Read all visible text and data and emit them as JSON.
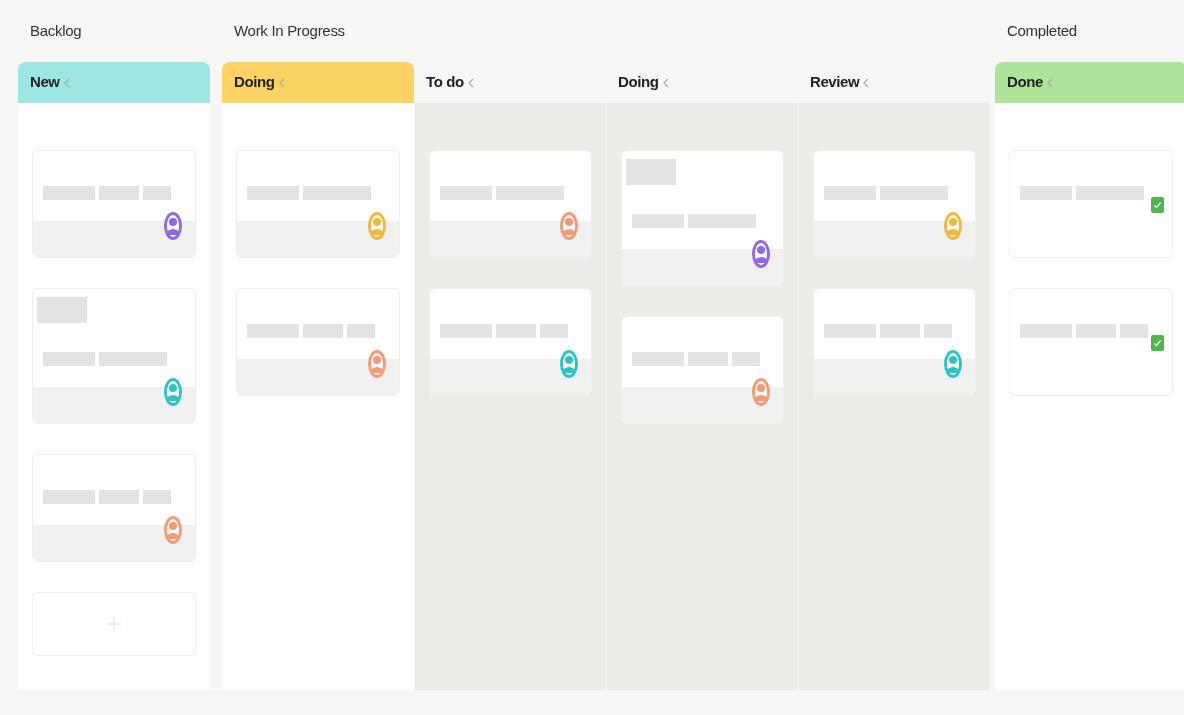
{
  "groups": [
    {
      "title": "Backlog",
      "columns": [
        {
          "name": "New",
          "color": "#9ee6e4",
          "cards": [
            {
              "kind": "task",
              "title_block": false,
              "color": "#8e6ae6"
            },
            {
              "kind": "task",
              "title_block": true,
              "color": "#2ec4c6"
            },
            {
              "kind": "task",
              "title_block": false,
              "color": "#f59a72"
            },
            {
              "kind": "add"
            }
          ]
        }
      ]
    },
    {
      "title": "Work In Progress",
      "columns": [
        {
          "name": "Doing",
          "color": "#fdd265",
          "cards": [
            {
              "kind": "task",
              "title_block": false,
              "color": "#f0b93a"
            },
            {
              "kind": "task",
              "title_block": false,
              "color": "#f59a72"
            }
          ]
        },
        {
          "name": "To do",
          "cards": [
            {
              "kind": "task",
              "title_block": false,
              "color": "#f59a72"
            },
            {
              "kind": "task",
              "title_block": false,
              "color": "#2ec4c6"
            }
          ]
        },
        {
          "name": "Doing",
          "cards": [
            {
              "kind": "task",
              "title_block": true,
              "color": "#8e6ae6"
            },
            {
              "kind": "task",
              "title_block": false,
              "color": "#f59a72"
            }
          ]
        },
        {
          "name": "Review",
          "cards": [
            {
              "kind": "task",
              "title_block": false,
              "color": "#f0b93a"
            },
            {
              "kind": "task",
              "title_block": false,
              "color": "#2ec4c6"
            }
          ]
        }
      ]
    },
    {
      "title": "Completed",
      "columns": [
        {
          "name": "Done",
          "color": "#aee39a",
          "cards": [
            {
              "kind": "done",
              "checked": true
            },
            {
              "kind": "done",
              "checked": true
            }
          ]
        }
      ]
    }
  ]
}
